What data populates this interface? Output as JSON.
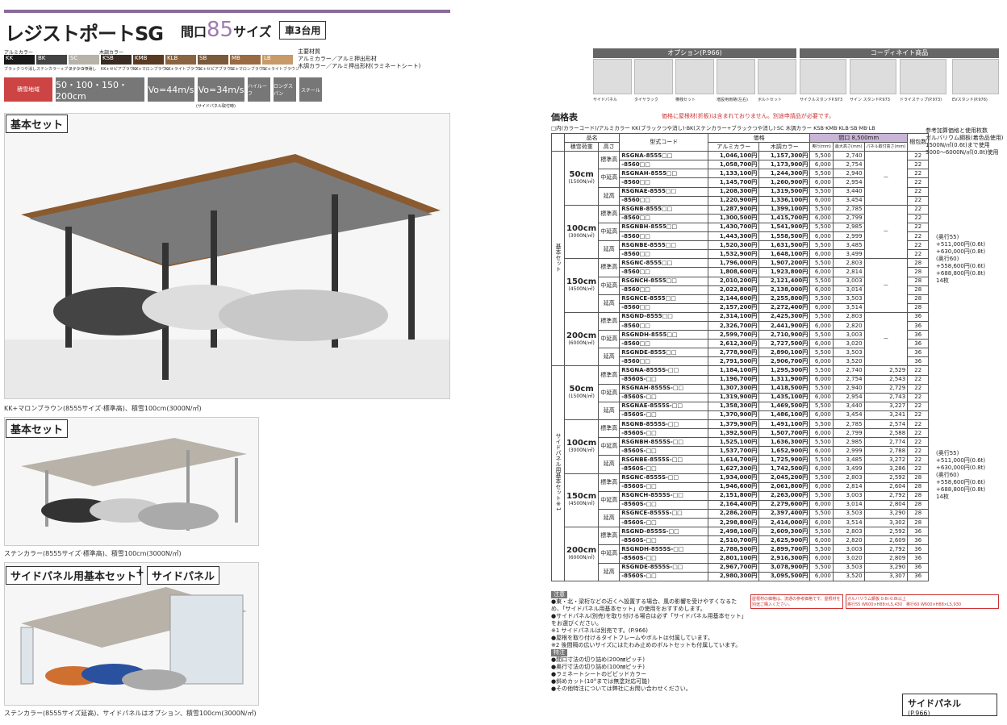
{
  "header": {
    "title": "レジストポートSG",
    "maguchi": "間口",
    "maguchi_num": "85",
    "maguchi_suffix": "サイズ",
    "car_badge": "車3台用"
  },
  "colors": {
    "aluminum_label": "アルミカラー",
    "wood_label": "木調カラー",
    "swatches": [
      {
        "code": "KK",
        "name": "ブラックつや消し",
        "hex": "#1a1a1a"
      },
      {
        "code": "BK",
        "name": "ステンカラー+ブラックつや消し",
        "hex": "#444"
      },
      {
        "code": "SC",
        "name": "ステンカラー",
        "hex": "#b7b2a8"
      },
      {
        "code": "KSB",
        "name": "KK+セピアブラウン",
        "hex": "#3a2c22"
      },
      {
        "code": "KMB",
        "name": "KK+マロンブラウン",
        "hex": "#5a3a22"
      },
      {
        "code": "KLB",
        "name": "KK+ライトブラウン",
        "hex": "#8a6440"
      },
      {
        "code": "SB",
        "name": "SC+セピアブラウン",
        "hex": "#7a5a3a"
      },
      {
        "code": "MB",
        "name": "SC+マロンブラウン",
        "hex": "#9a6a40"
      },
      {
        "code": "LB",
        "name": "SC+ライトブラウン",
        "hex": "#c89a68"
      }
    ],
    "materials": [
      "主要材質",
      "アルミカラー／アルミ押出形材",
      "木調カラー／アルミ押出形材(ラミネートシート)"
    ]
  },
  "specs": [
    "積雪地域",
    "50・100・150・200cm",
    "Vo=44m/s",
    "Vo=34m/s",
    "ハイルーフ",
    "ロングスパン",
    "スチール"
  ],
  "spec_note": "(サイドパネル取付時)",
  "sections": {
    "basic1": "基本セット",
    "basic2": "基本セット",
    "side_basic": "サイドパネル用基本セット",
    "plus": "+",
    "side_panel": "サイドパネル"
  },
  "captions": {
    "c1": "KK+マロンブラウン(8555サイズ·標準高)、積雪100cm(3000N/㎡)",
    "c2": "ステンカラー(8555サイズ·標準高)、積雪100cm(3000N/㎡)",
    "c3": "ステンカラー(8555サイズ延高)、サイドパネルはオプション、積雪100cm(3000N/㎡)"
  },
  "options": {
    "option_head": "オプション(P.966)",
    "coord_head": "コーディネイト商品",
    "items": [
      "サイドパネル",
      "タイヤラック",
      "横桟セット",
      "増設用雨樋(左右)",
      "ボルトセット",
      "サイクルスタンドP.973",
      "サイン スタンドP.973",
      "ドライステップ(P.973)",
      "EVスタンド(P.976)"
    ]
  },
  "price": {
    "title": "価格表",
    "note": "価格に屋根材(折板)は含まれておりません。別途申請品が必要です。",
    "color_line": "□内(カラーコード)/アルミカラー KK(ブラックつや消し)·BK(ステンカラー+ブラックつや消し)·SC 木調カラー KSB·KMB·KLB·SB·MB·LB",
    "h_name": "品名",
    "h_snow": "積雪荷重",
    "h_height": "高さ",
    "h_code": "型式コード",
    "h_price": "価格",
    "h_alu": "アルミカラー",
    "h_wood": "木調カラー",
    "h_size": "間口 8,500mm",
    "h_depth": "奥行(mm)",
    "h_maxh": "最大高さ(mm)",
    "h_panel": "パネル取付高さ(mm)",
    "h_pack": "梱包数",
    "group1": "基本セット",
    "group2": "サイドパネル用基本セット※1",
    "rows": [
      [
        "50cm",
        "標準高",
        "RSGNA-8555□□",
        "1,046,100円",
        "1,157,300円",
        "5,500",
        "2,740",
        "",
        "22"
      ],
      [
        "",
        "",
        "-8560□□",
        "1,058,700円",
        "1,173,900円",
        "6,000",
        "2,754",
        "",
        "22"
      ],
      [
        "",
        "中延高",
        "RSGNAH-8555□□",
        "1,133,100円",
        "1,244,300円",
        "5,500",
        "2,940",
        "",
        "22"
      ],
      [
        "",
        "",
        "-8560□□",
        "1,145,700円",
        "1,260,900円",
        "6,000",
        "2,954",
        "",
        "22"
      ],
      [
        "",
        "延高",
        "RSGNAE-8555□□",
        "1,208,300円",
        "1,319,500円",
        "5,500",
        "3,440",
        "",
        "22"
      ],
      [
        "",
        "",
        "-8560□□",
        "1,220,900円",
        "1,336,100円",
        "6,000",
        "3,454",
        "",
        "22"
      ],
      [
        "100cm",
        "標準高",
        "RSGNB-8555□□",
        "1,287,900円",
        "1,399,100円",
        "5,500",
        "2,785",
        "",
        "22"
      ],
      [
        "",
        "",
        "-8560□□",
        "1,300,500円",
        "1,415,700円",
        "6,000",
        "2,799",
        "",
        "22"
      ],
      [
        "",
        "中延高",
        "RSGNBH-8555□□",
        "1,430,700円",
        "1,541,900円",
        "5,500",
        "2,985",
        "",
        "22"
      ],
      [
        "",
        "",
        "-8560□□",
        "1,443,300円",
        "1,558,500円",
        "6,000",
        "2,999",
        "",
        "22"
      ],
      [
        "",
        "延高",
        "RSGNBE-8555□□",
        "1,520,300円",
        "1,631,500円",
        "5,500",
        "3,485",
        "",
        "22"
      ],
      [
        "",
        "",
        "-8560□□",
        "1,532,900円",
        "1,648,100円",
        "6,000",
        "3,499",
        "",
        "22"
      ],
      [
        "150cm",
        "標準高",
        "RSGNC-8555□□",
        "1,796,000円",
        "1,907,200円",
        "5,500",
        "2,803",
        "",
        "28"
      ],
      [
        "",
        "",
        "-8560□□",
        "1,808,600円",
        "1,923,800円",
        "6,000",
        "2,814",
        "",
        "28"
      ],
      [
        "",
        "中延高",
        "RSGNCH-8555□□",
        "2,010,200円",
        "2,121,400円",
        "5,500",
        "3,003",
        "",
        "28"
      ],
      [
        "",
        "",
        "-8560□□",
        "2,022,800円",
        "2,138,000円",
        "6,000",
        "3,014",
        "",
        "28"
      ],
      [
        "",
        "延高",
        "RSGNCE-8555□□",
        "2,144,600円",
        "2,255,800円",
        "5,500",
        "3,503",
        "",
        "28"
      ],
      [
        "",
        "",
        "-8560□□",
        "2,157,200円",
        "2,272,400円",
        "6,000",
        "3,514",
        "",
        "28"
      ],
      [
        "200cm",
        "標準高",
        "RSGND-8555□□",
        "2,314,100円",
        "2,425,300円",
        "5,500",
        "2,803",
        "",
        "36"
      ],
      [
        "",
        "",
        "-8560□□",
        "2,326,700円",
        "2,441,900円",
        "6,000",
        "2,820",
        "",
        "36"
      ],
      [
        "",
        "中延高",
        "RSGNDH-8555□□",
        "2,599,700円",
        "2,710,900円",
        "5,500",
        "3,003",
        "",
        "36"
      ],
      [
        "",
        "",
        "-8560□□",
        "2,612,300円",
        "2,727,500円",
        "6,000",
        "3,020",
        "",
        "36"
      ],
      [
        "",
        "延高",
        "RSGNDE-8555□□",
        "2,778,900円",
        "2,890,100円",
        "5,500",
        "3,503",
        "",
        "36"
      ],
      [
        "",
        "",
        "-8560□□",
        "2,791,500円",
        "2,906,700円",
        "6,000",
        "3,520",
        "",
        "36"
      ],
      [
        "50cm",
        "標準高",
        "RSGNA-8555S-□□",
        "1,184,100円",
        "1,295,300円",
        "5,500",
        "2,740",
        "2,529",
        "22"
      ],
      [
        "",
        "",
        "-8560S-□□",
        "1,196,700円",
        "1,311,900円",
        "6,000",
        "2,754",
        "2,543",
        "22"
      ],
      [
        "",
        "中延高",
        "RSGNAH-8555S-□□",
        "1,307,300円",
        "1,418,500円",
        "5,500",
        "2,940",
        "2,729",
        "22"
      ],
      [
        "",
        "",
        "-8560S-□□",
        "1,319,900円",
        "1,435,100円",
        "6,000",
        "2,954",
        "2,743",
        "22"
      ],
      [
        "",
        "延高",
        "RSGNAE-8555S-□□",
        "1,358,300円",
        "1,469,500円",
        "5,500",
        "3,440",
        "3,227",
        "22"
      ],
      [
        "",
        "",
        "-8560S-□□",
        "1,370,900円",
        "1,486,100円",
        "6,000",
        "3,454",
        "3,241",
        "22"
      ],
      [
        "100cm",
        "標準高",
        "RSGNB-8555S-□□",
        "1,379,900円",
        "1,491,100円",
        "5,500",
        "2,785",
        "2,574",
        "22"
      ],
      [
        "",
        "",
        "-8560S-□□",
        "1,392,500円",
        "1,507,700円",
        "6,000",
        "2,799",
        "2,588",
        "22"
      ],
      [
        "",
        "中延高",
        "RSGNBH-8555S-□□",
        "1,525,100円",
        "1,636,300円",
        "5,500",
        "2,985",
        "2,774",
        "22"
      ],
      [
        "",
        "",
        "-8560S-□□",
        "1,537,700円",
        "1,652,900円",
        "6,000",
        "2,999",
        "2,788",
        "22"
      ],
      [
        "",
        "延高",
        "RSGNBE-8555S-□□",
        "1,614,700円",
        "1,725,900円",
        "5,500",
        "3,485",
        "3,272",
        "22"
      ],
      [
        "",
        "",
        "-8560S-□□",
        "1,627,300円",
        "1,742,500円",
        "6,000",
        "3,499",
        "3,286",
        "22"
      ],
      [
        "150cm",
        "標準高",
        "RSGNC-8555S-□□",
        "1,934,000円",
        "2,045,200円",
        "5,500",
        "2,803",
        "2,592",
        "28"
      ],
      [
        "",
        "",
        "-8560S-□□",
        "1,946,600円",
        "2,061,800円",
        "6,000",
        "2,814",
        "2,604",
        "28"
      ],
      [
        "",
        "中延高",
        "RSGNCH-8555S-□□",
        "2,151,800円",
        "2,263,000円",
        "5,500",
        "3,003",
        "2,792",
        "28"
      ],
      [
        "",
        "",
        "-8560S-□□",
        "2,164,400円",
        "2,279,600円",
        "6,000",
        "3,014",
        "2,804",
        "28"
      ],
      [
        "",
        "延高",
        "RSGNCE-8555S-□□",
        "2,286,200円",
        "2,397,400円",
        "5,500",
        "3,503",
        "3,290",
        "28"
      ],
      [
        "",
        "",
        "-8560S-□□",
        "2,298,800円",
        "2,414,000円",
        "6,000",
        "3,514",
        "3,302",
        "28"
      ],
      [
        "200cm",
        "標準高",
        "RSGND-8555S-□□",
        "2,498,100円",
        "2,609,300円",
        "5,500",
        "2,803",
        "2,592",
        "36"
      ],
      [
        "",
        "",
        "-8560S-□□",
        "2,510,700円",
        "2,625,900円",
        "6,000",
        "2,820",
        "2,609",
        "36"
      ],
      [
        "",
        "中延高",
        "RSGNDH-8555S-□□",
        "2,788,500円",
        "2,899,700円",
        "5,500",
        "3,003",
        "2,792",
        "36"
      ],
      [
        "",
        "",
        "-8560S-□□",
        "2,801,100円",
        "2,916,300円",
        "6,000",
        "3,020",
        "2,809",
        "36"
      ],
      [
        "",
        "延高",
        "RSGNDE-8555S-□□",
        "2,967,700円",
        "3,078,900円",
        "5,500",
        "3,503",
        "3,290",
        "36"
      ],
      [
        "",
        "",
        "-8560S-□□",
        "2,980,300円",
        "3,095,500円",
        "6,000",
        "3,520",
        "3,307",
        "36"
      ]
    ],
    "snow_sub": {
      "50cm": "(1500N/㎡)",
      "100cm": "(3000N/㎡)",
      "150cm": "(4500N/㎡)",
      "200cm": "(6000N/㎡)"
    },
    "dash": "－"
  },
  "side_info": {
    "ref_head": [
      "参考加算価格と使用枚数",
      "ガルバリウム鋼板(着色品使用)",
      "1500N/㎡(0.6t)まで使用",
      "3000〜6000N/㎡(0.8t)使用"
    ],
    "upper": [
      "(奥行55)",
      "+511,000円(0.6t)",
      "+630,000円(0.8t)",
      "(奥行60)",
      "+558,600円(0.6t)",
      "+688,800円(0.8t)",
      "14枚"
    ],
    "lower": [
      "(奥行55)",
      "+511,000円(0.6t)",
      "+630,000円(0.8t)",
      "(奥行60)",
      "+558,600円(0.6t)",
      "+688,800円(0.8t)",
      "14枚"
    ]
  },
  "notes": {
    "head1": "注意",
    "head2": "特注",
    "n1": [
      "●東・北・梁桁などの近くへ設置する場合、風の影響を受けやすくなるため、「サイドパネル用基本セット」の使用をおすすめします。",
      "●サイドパネル(別売)を取り付ける場合は必ず「サイドパネル用基本セット」をお選びください。",
      "※1 サイドパネルは別売です。(P.966)",
      "●屋根を取り付けるタイトフレームやボルトは付属しています。",
      "※2 後間隔の広いサイズにはたわみ止めのボルトセットも付属しています。"
    ],
    "n2": [
      "●間口寸法の切り詰め(200㎜ピッチ)",
      "●奥行寸法の切り詰め(100㎜ピッチ)",
      "●ラミネートシートのビビッドカラー",
      "●斜めカット(10°までは無塗対応可能)",
      "●その他特注については弊社にお問い合わせください。"
    ],
    "pink": "屋根材の価格は、流通の参考価格です。屋根材を別途ご購入ください。",
    "galv": "ガルバリウム鋼板 0.6t·0.8t以上",
    "galv2": "奥行55 W600×H88×L5,430　奥行60 W600×H88×L5,930"
  },
  "footer": {
    "side_panel": "サイドパネル",
    "page": "(P.966)"
  }
}
